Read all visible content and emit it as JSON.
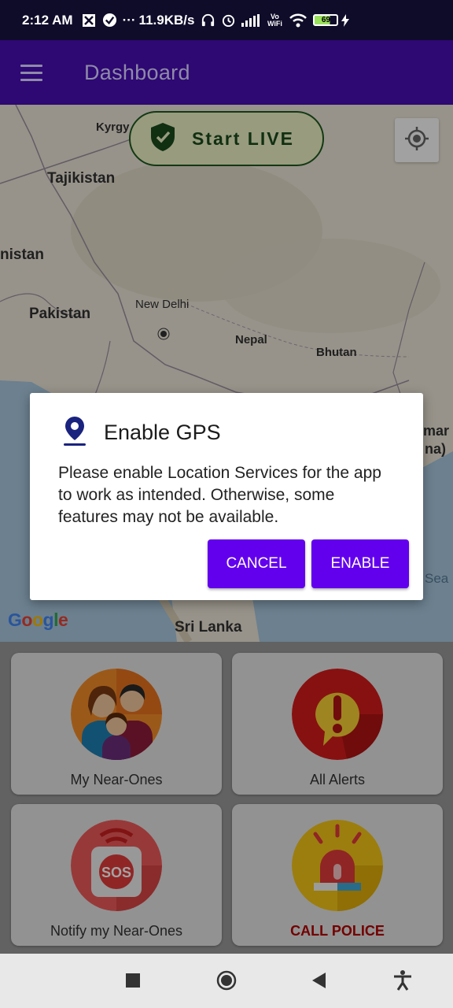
{
  "status_bar": {
    "time": "2:12 AM",
    "more": "···",
    "network_speed": "11.9KB/s",
    "vowifi": "Vo WiFi",
    "battery": "69"
  },
  "app_bar": {
    "title": "Dashboard",
    "menu_icon": "hamburger-menu-icon"
  },
  "map": {
    "start_live_label": "Start LIVE",
    "locate_icon": "my-location-icon",
    "labels": {
      "kyrgyz": "Kyrgy",
      "tajikistan": "Tajikistan",
      "afghanistan": "nistan",
      "pakistan": "Pakistan",
      "new_delhi": "New Delhi",
      "nepal": "Nepal",
      "bhutan": "Bhutan",
      "myanmar1": "mar",
      "myanmar2": "na)",
      "sea": "Sea",
      "sri_lanka": "Sri Lanka"
    },
    "google_logo": [
      "G",
      "o",
      "o",
      "g",
      "l",
      "e"
    ],
    "google_colors": [
      "#4285F4",
      "#EA4335",
      "#FBBC05",
      "#4285F4",
      "#34A853",
      "#EA4335"
    ]
  },
  "cards": [
    {
      "label": "My Near-Ones",
      "icon": "family-icon"
    },
    {
      "label": "All Alerts",
      "icon": "alert-icon"
    },
    {
      "label": "Notify my Near-Ones",
      "icon": "sos-icon"
    },
    {
      "label": "CALL POLICE",
      "icon": "police-siren-icon",
      "label_color": "#b40000"
    }
  ],
  "dialog": {
    "title": "Enable GPS",
    "message": "Please enable Location Services for the app to work as intended. Otherwise, some features may not be available.",
    "cancel_label": "CANCEL",
    "enable_label": "ENABLE",
    "accent": "#6200ee"
  },
  "colors": {
    "app_bar": "#2e0873",
    "status_bar": "#0f0c2a"
  }
}
